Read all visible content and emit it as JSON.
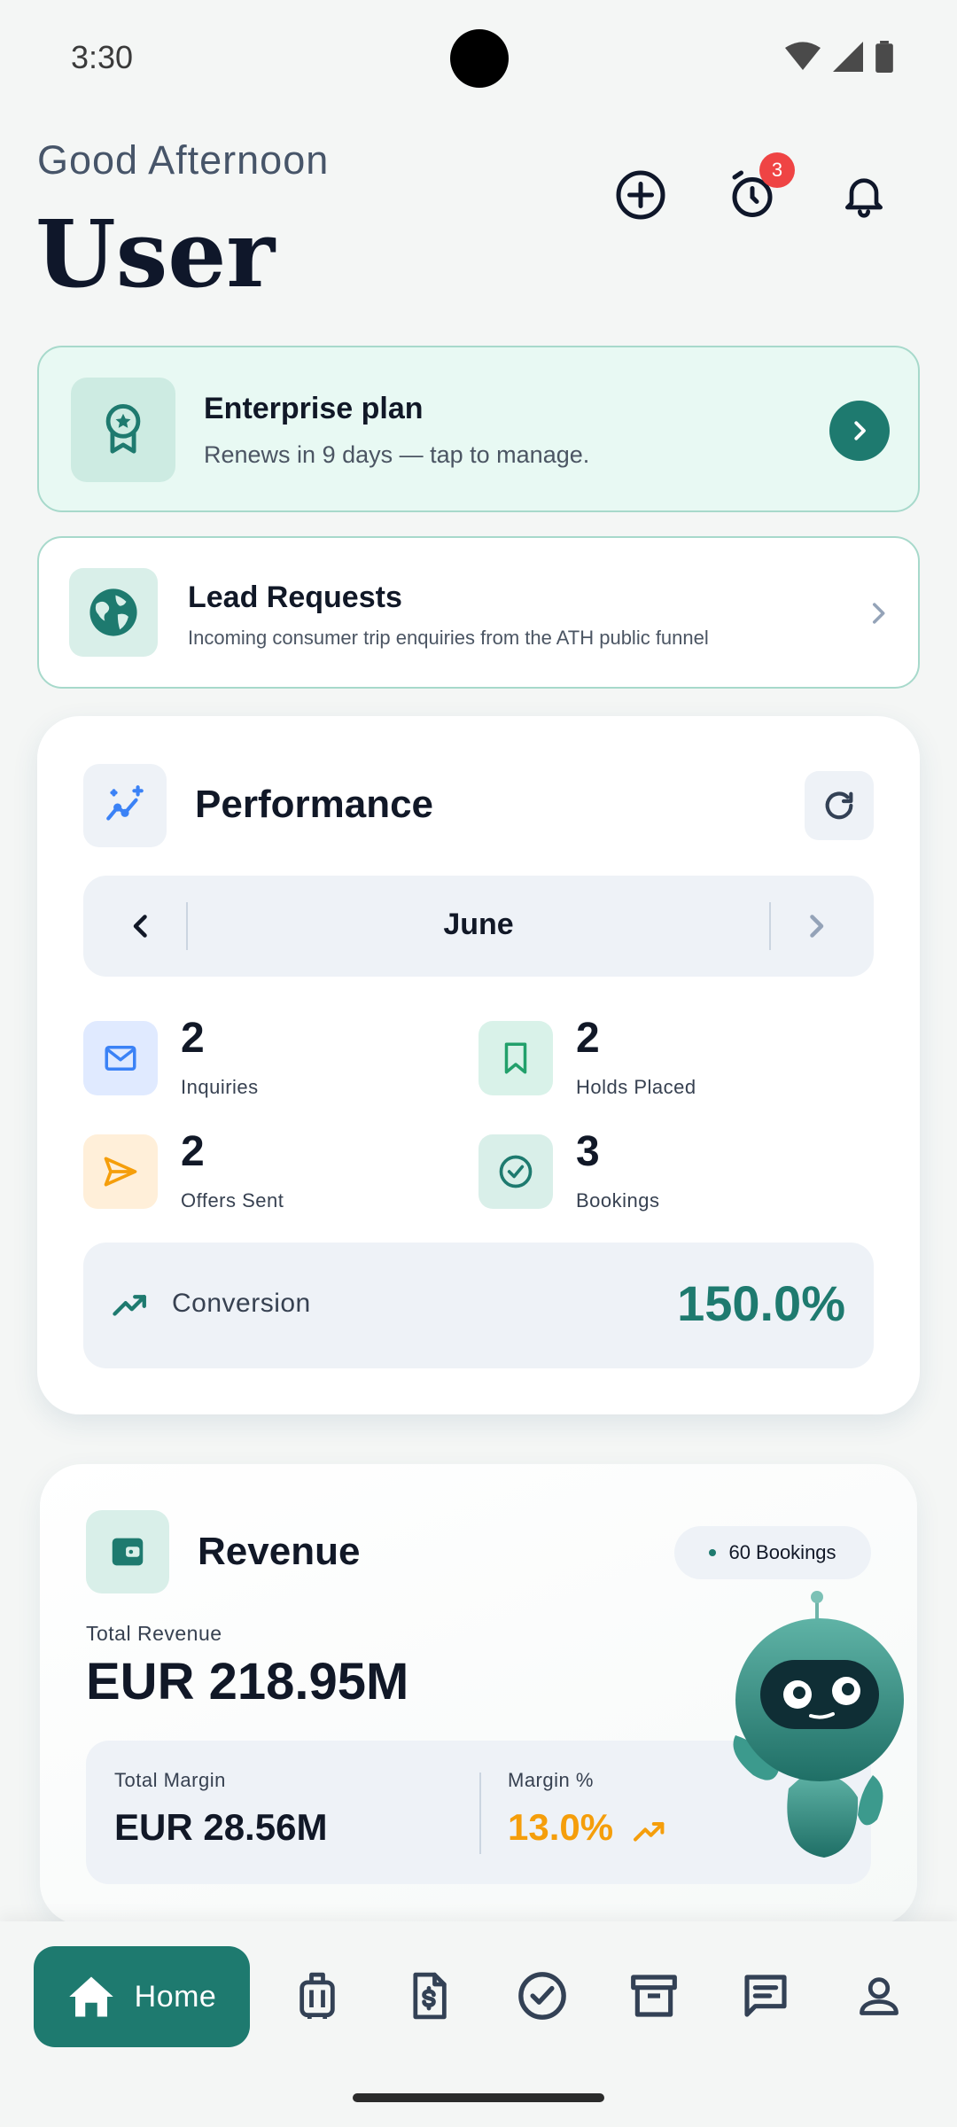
{
  "status_bar": {
    "time": "3:30"
  },
  "header": {
    "greeting": "Good Afternoon",
    "user_name": "User",
    "alarm_badge": "3"
  },
  "plan_card": {
    "title": "Enterprise plan",
    "subtitle": "Renews in 9 days — tap to manage."
  },
  "lead_card": {
    "title": "Lead Requests",
    "subtitle": "Incoming consumer trip enquiries from the ATH public funnel"
  },
  "performance": {
    "title": "Performance",
    "month": "June",
    "metrics": [
      {
        "value": "2",
        "label": "Inquiries",
        "icon": "mail-icon"
      },
      {
        "value": "2",
        "label": "Holds Placed",
        "icon": "bookmark-icon"
      },
      {
        "value": "2",
        "label": "Offers Sent",
        "icon": "send-icon"
      },
      {
        "value": "3",
        "label": "Bookings",
        "icon": "check-circle-icon"
      }
    ],
    "conversion": {
      "label": "Conversion",
      "value": "150.0%"
    }
  },
  "revenue": {
    "title": "Revenue",
    "bookings_pill": "60 Bookings",
    "total_label": "Total Revenue",
    "total_value": "EUR 218.95M",
    "margin_label": "Total Margin",
    "margin_value": "EUR 28.56M",
    "margin_pct_label": "Margin %",
    "margin_pct_value": "13.0%"
  },
  "bottom_nav": {
    "home_label": "Home",
    "items": [
      "luggage-icon",
      "invoice-icon",
      "check-circle-icon",
      "archive-icon",
      "chat-icon",
      "person-icon"
    ]
  },
  "colors": {
    "accent": "#1e7a6f",
    "warning": "#f59e0b",
    "badge": "#ef4444"
  }
}
